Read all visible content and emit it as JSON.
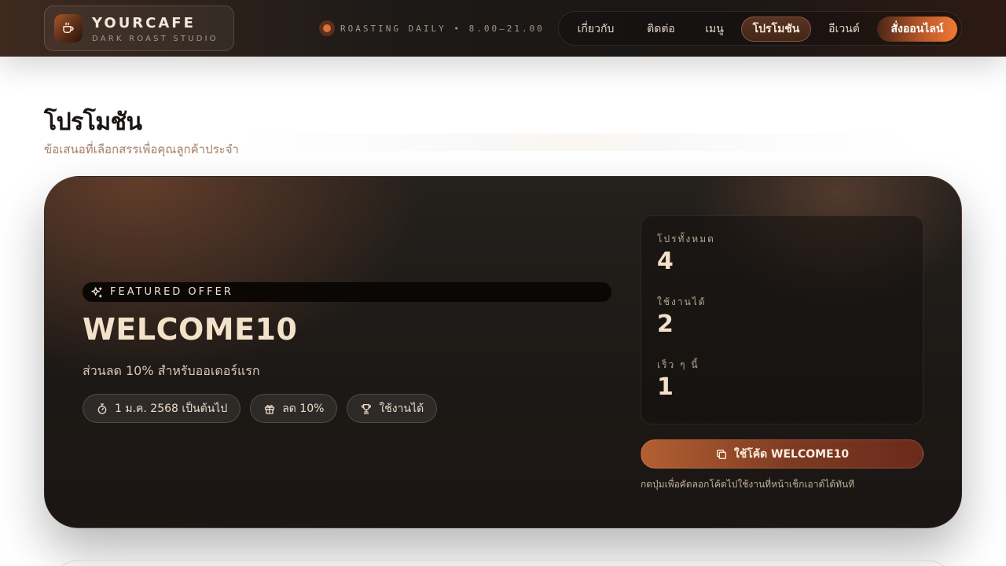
{
  "header": {
    "brand_name": "YOURCAFE",
    "brand_sub": "DARK ROAST STUDIO",
    "logo_icon": "coffee-cup-icon",
    "status_text": "ROASTING DAILY • 8.00–21.00",
    "nav": [
      {
        "label": "เกี่ยวกับ",
        "active": false
      },
      {
        "label": "ติดต่อ",
        "active": false
      },
      {
        "label": "เมนู",
        "active": false
      },
      {
        "label": "โปรโมชัน",
        "active": true
      },
      {
        "label": "อีเวนต์",
        "active": false
      },
      {
        "label": "สั่งออนไลน์",
        "cta": true
      }
    ]
  },
  "page": {
    "title": "โปรโมชัน",
    "subtitle": "ข้อเสนอที่เลือกสรรเพื่อคุณลูกค้าประจำ"
  },
  "featured": {
    "badge": "FEATURED OFFER",
    "badge_icon": "sparkles-icon",
    "code": "WELCOME10",
    "description": "ส่วนลด 10% สำหรับออเดอร์แรก",
    "chips": [
      {
        "icon": "timer-icon",
        "label": "1 ม.ค. 2568 เป็นต้นไป"
      },
      {
        "icon": "gift-icon",
        "label": "ลด 10%"
      },
      {
        "icon": "trophy-icon",
        "label": "ใช้งานได้"
      }
    ],
    "stats": [
      {
        "label": "โปรทั้งหมด",
        "value": "4"
      },
      {
        "label": "ใช้งานได้",
        "value": "2"
      },
      {
        "label": "เร็ว ๆ นี้",
        "value": "1"
      }
    ],
    "use_button": "ใช้โค้ด WELCOME10",
    "use_button_icon": "copy-icon",
    "hint": "กดปุ่มเพื่อคัดลอกโค้ดไปใช้งานที่หน้าเช็กเอาต์ได้ทันที"
  },
  "colors": {
    "accent": "#d9713a",
    "hero_text": "#f4e1c9",
    "subtitle": "#a47f68"
  }
}
